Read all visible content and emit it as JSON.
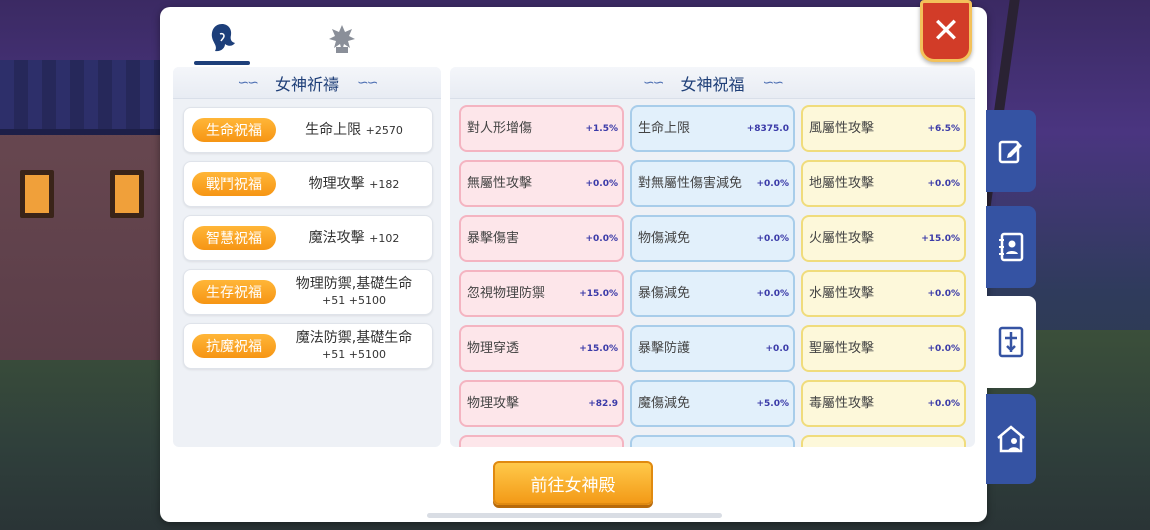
{
  "tabs": [
    {
      "icon": "goddess-hair-icon",
      "active": true
    },
    {
      "icon": "crest-icon",
      "active": false
    }
  ],
  "close_label": "✕",
  "left_section": {
    "title": "女神祈禱",
    "blessings": [
      {
        "label": "生命祝福",
        "stat": "生命上限",
        "value": "+2570"
      },
      {
        "label": "戰鬥祝福",
        "stat": "物理攻擊",
        "value": "+182"
      },
      {
        "label": "智慧祝福",
        "stat": "魔法攻擊",
        "value": "+102"
      },
      {
        "label": "生存祝福",
        "stat": "物理防禦,基礎生命",
        "value": "+51 +5100"
      },
      {
        "label": "抗魔祝福",
        "stat": "魔法防禦,基礎生命",
        "value": "+51 +5100"
      }
    ]
  },
  "right_section": {
    "title": "女神祝福",
    "stats": [
      {
        "name": "對人形增傷",
        "value": "+1.5%",
        "color": "pink"
      },
      {
        "name": "生命上限",
        "value": "+8375.0",
        "color": "blue"
      },
      {
        "name": "風屬性攻擊",
        "value": "+6.5%",
        "color": "yellow"
      },
      {
        "name": "無屬性攻擊",
        "value": "+0.0%",
        "color": "pink"
      },
      {
        "name": "對無屬性傷害減免",
        "value": "+0.0%",
        "color": "blue"
      },
      {
        "name": "地屬性攻擊",
        "value": "+0.0%",
        "color": "yellow"
      },
      {
        "name": "暴擊傷害",
        "value": "+0.0%",
        "color": "pink"
      },
      {
        "name": "物傷減免",
        "value": "+0.0%",
        "color": "blue"
      },
      {
        "name": "火屬性攻擊",
        "value": "+15.0%",
        "color": "yellow"
      },
      {
        "name": "忽視物理防禦",
        "value": "+15.0%",
        "color": "pink"
      },
      {
        "name": "暴傷減免",
        "value": "+0.0%",
        "color": "blue"
      },
      {
        "name": "水屬性攻擊",
        "value": "+0.0%",
        "color": "yellow"
      },
      {
        "name": "物理穿透",
        "value": "+15.0%",
        "color": "pink"
      },
      {
        "name": "暴擊防護",
        "value": "+0.0",
        "color": "blue"
      },
      {
        "name": "聖屬性攻擊",
        "value": "+0.0%",
        "color": "yellow"
      },
      {
        "name": "物理攻擊",
        "value": "+82.9",
        "color": "pink"
      },
      {
        "name": "魔傷減免",
        "value": "+5.0%",
        "color": "blue"
      },
      {
        "name": "毒屬性攻擊",
        "value": "+0.0%",
        "color": "yellow"
      }
    ]
  },
  "goto_button": "前往女神殿",
  "side_nav": [
    {
      "icon": "edit-icon",
      "active": false
    },
    {
      "icon": "contacts-book-icon",
      "active": false
    },
    {
      "icon": "goddess-tablet-icon",
      "active": true
    },
    {
      "icon": "guild-house-icon",
      "active": false
    }
  ],
  "colors": {
    "accent_orange": "#f69514",
    "nav_blue": "#3553a3",
    "close_red": "#d23c28",
    "title_blue": "#1f3f78"
  }
}
